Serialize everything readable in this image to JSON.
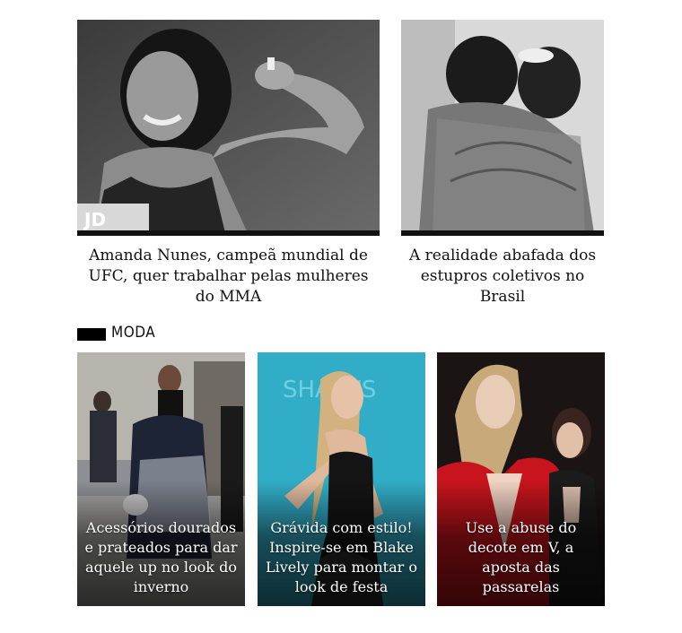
{
  "features": [
    {
      "title": "Amanda Nunes, campeã mundial de UFC, quer trabalhar pelas mulheres do MMA"
    },
    {
      "title": "A realidade abafada dos estupros coletivos no Brasil"
    }
  ],
  "section": {
    "label": "MODA"
  },
  "cards": [
    {
      "caption": "Acessórios dourados e prateados para dar aquele up no look do inverno"
    },
    {
      "caption": "Grávida com estilo! Inspire-se em Blake Lively para montar o look de festa"
    },
    {
      "caption": "Use a abuse do decote em V, a aposta das passarelas"
    }
  ],
  "colors": {
    "card2_bg": "#35b4cc",
    "card3_dress": "#c8141c"
  }
}
